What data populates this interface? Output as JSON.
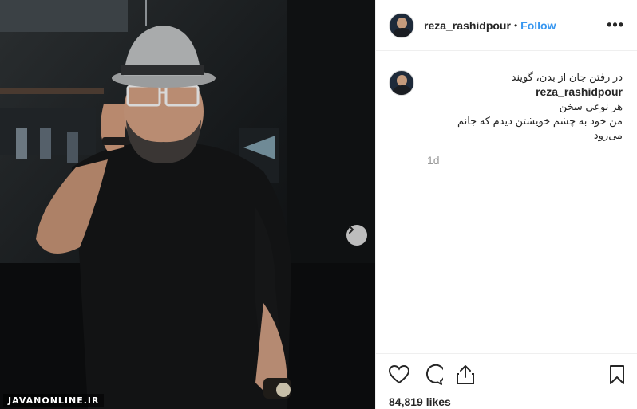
{
  "post": {
    "username": "reza_rashidpour",
    "separator": "•",
    "follow_label": "Follow",
    "more_label": "•••",
    "watermark": "JAVANONLINE.IR",
    "caption": {
      "username": "reza_rashidpour",
      "line1": "در رفتن جان از بدن، گویند",
      "line2": "هر نوعی سخن",
      "line3": "من خود به چشم خویشتن دیدم که جانم می‌رود"
    },
    "time_ago": "1d",
    "likes": "84,819 likes"
  },
  "icons": {
    "next": "chevron-right-icon",
    "like": "heart-icon",
    "comment": "comment-icon",
    "share": "share-icon",
    "save": "bookmark-icon",
    "more": "more-options-icon"
  },
  "colors": {
    "accent": "#3897f0",
    "text": "#262626",
    "muted": "#999999",
    "border": "#efefef"
  }
}
